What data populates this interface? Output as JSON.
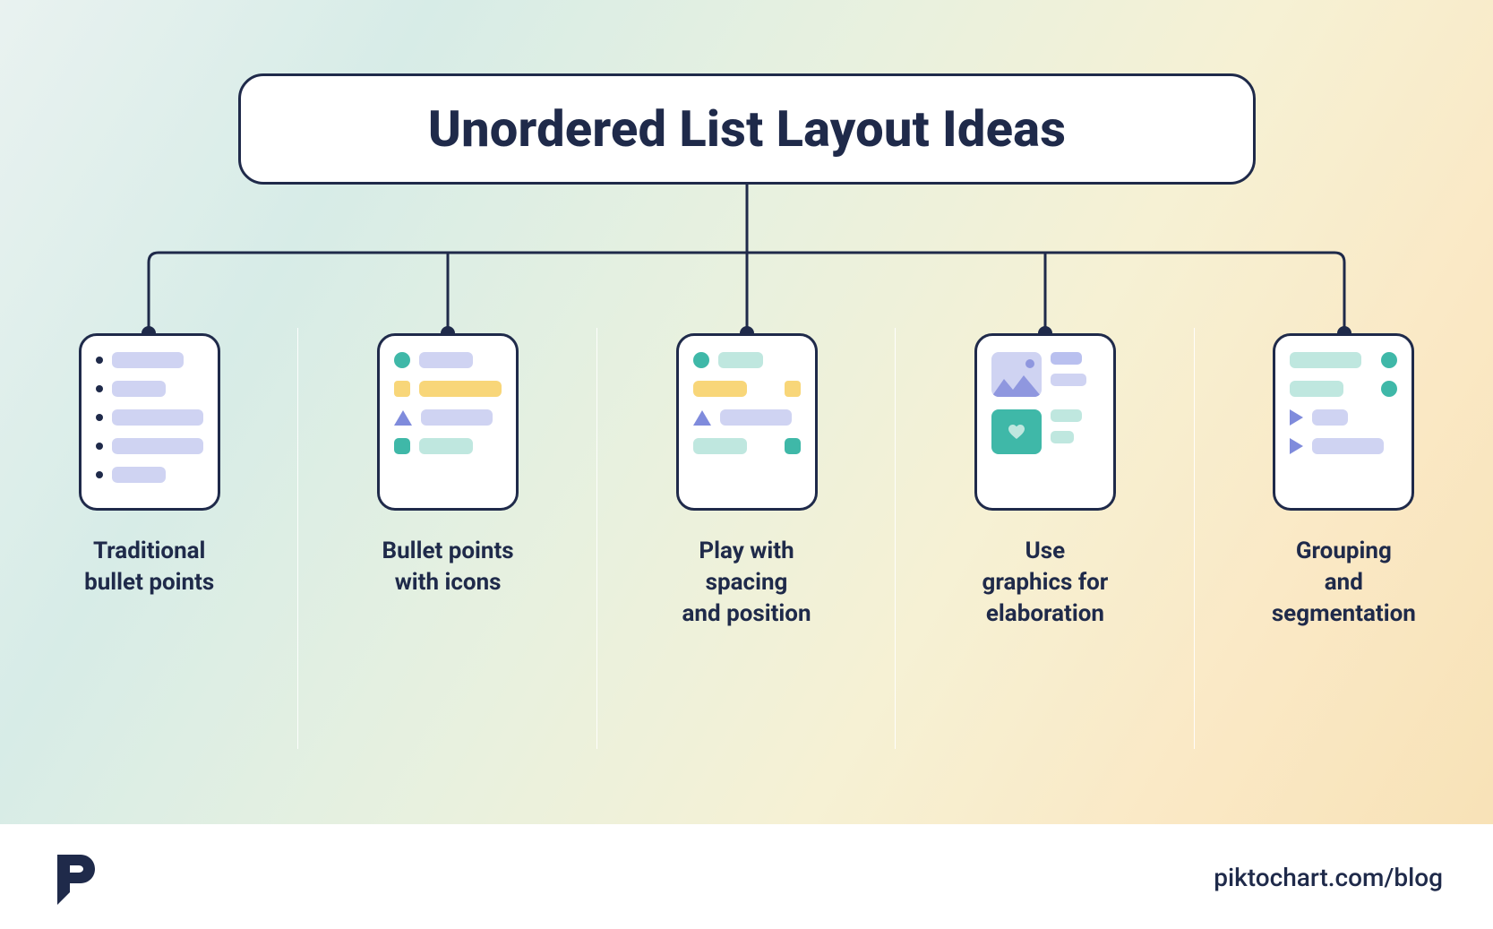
{
  "title": "Unordered List Layout Ideas",
  "cards": [
    {
      "label": "Traditional\nbullet points"
    },
    {
      "label": "Bullet points\nwith icons"
    },
    {
      "label": "Play with\nspacing\nand position"
    },
    {
      "label": "Use\ngraphics for\nelaboration"
    },
    {
      "label": "Grouping\nand\nsegmentation"
    }
  ],
  "footer": {
    "site": "piktochart.com/blog"
  },
  "palette": {
    "ink": "#1f2a4a",
    "lavender": "#cfd3f2",
    "lavender2": "#b9c0ef",
    "teal": "#3fb8a8",
    "tealLight": "#bfe7df",
    "yellow": "#f8d679"
  }
}
